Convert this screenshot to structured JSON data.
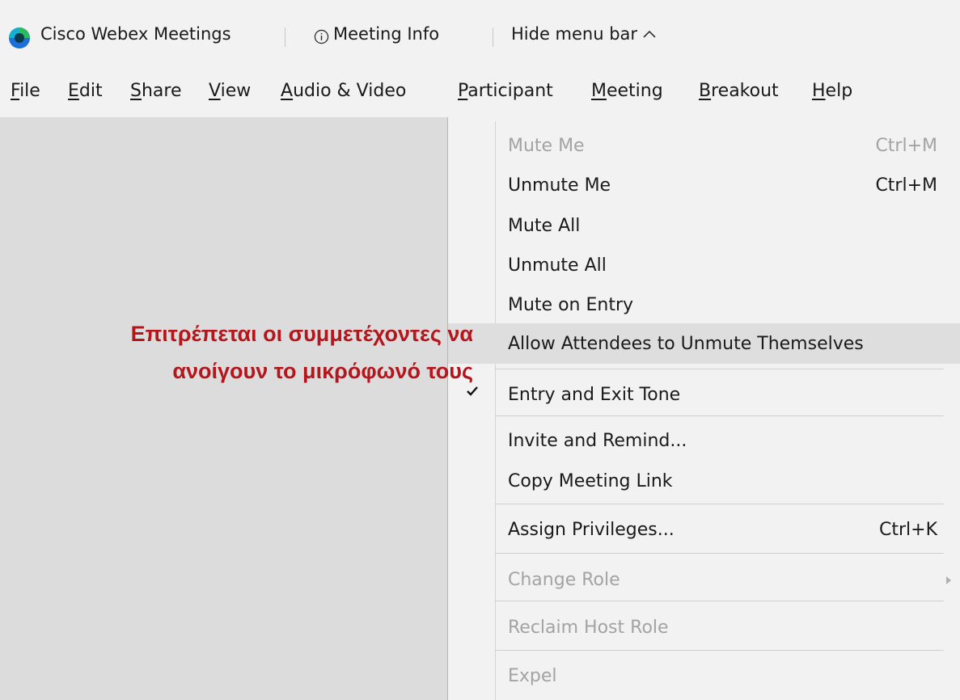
{
  "titlebar": {
    "app_name": "Cisco Webex Meetings",
    "meeting_info": "Meeting Info",
    "hide_menu": "Hide menu bar"
  },
  "menubar": [
    {
      "label": "File",
      "mnemonic_index": 0
    },
    {
      "label": "Edit",
      "mnemonic_index": 0
    },
    {
      "label": "Share",
      "mnemonic_index": 0
    },
    {
      "label": "View",
      "mnemonic_index": 0
    },
    {
      "label": "Audio & Video",
      "mnemonic_index": 0
    },
    {
      "label": "Participant",
      "mnemonic_index": 0
    },
    {
      "label": "Meeting",
      "mnemonic_index": 0
    },
    {
      "label": "Breakout",
      "mnemonic_index": 0
    },
    {
      "label": "Help",
      "mnemonic_index": 0
    }
  ],
  "participant_menu": {
    "items": [
      {
        "label": "Mute Me",
        "shortcut": "Ctrl+M",
        "enabled": false
      },
      {
        "label": "Unmute Me",
        "shortcut": "Ctrl+M",
        "enabled": true
      },
      {
        "label": "Mute All",
        "shortcut": "",
        "enabled": true
      },
      {
        "label": "Unmute All",
        "shortcut": "",
        "enabled": true
      },
      {
        "label": "Mute on Entry",
        "shortcut": "",
        "enabled": true
      },
      {
        "label": "Allow Attendees to Unmute Themselves",
        "shortcut": "",
        "enabled": true,
        "highlighted": true
      },
      {
        "label": "Entry and Exit Tone",
        "shortcut": "",
        "enabled": true,
        "checked": true
      },
      {
        "label": "Invite and Remind...",
        "shortcut": "",
        "enabled": true
      },
      {
        "label": "Copy Meeting Link",
        "shortcut": "",
        "enabled": true
      },
      {
        "label": "Assign Privileges...",
        "shortcut": "Ctrl+K",
        "enabled": true
      },
      {
        "label": "Change Role",
        "shortcut": "",
        "enabled": false,
        "submenu": true
      },
      {
        "label": "Reclaim Host Role",
        "shortcut": "",
        "enabled": false
      },
      {
        "label": "Expel",
        "shortcut": "",
        "enabled": false
      }
    ]
  },
  "annotation": {
    "line1": "Επιτρέπεται οι συμμετέχοντες να",
    "line2": "ανοίγουν το μικρόφωνό τους",
    "color": "#b4161c"
  },
  "colors": {
    "menu_bg": "#f2f2f2",
    "workspace_bg": "#dcdcdc",
    "hover_bg": "#dedede",
    "disabled_text": "#a3a3a3",
    "webex_blue": "#1c6fd8",
    "webex_green": "#2fb862"
  }
}
